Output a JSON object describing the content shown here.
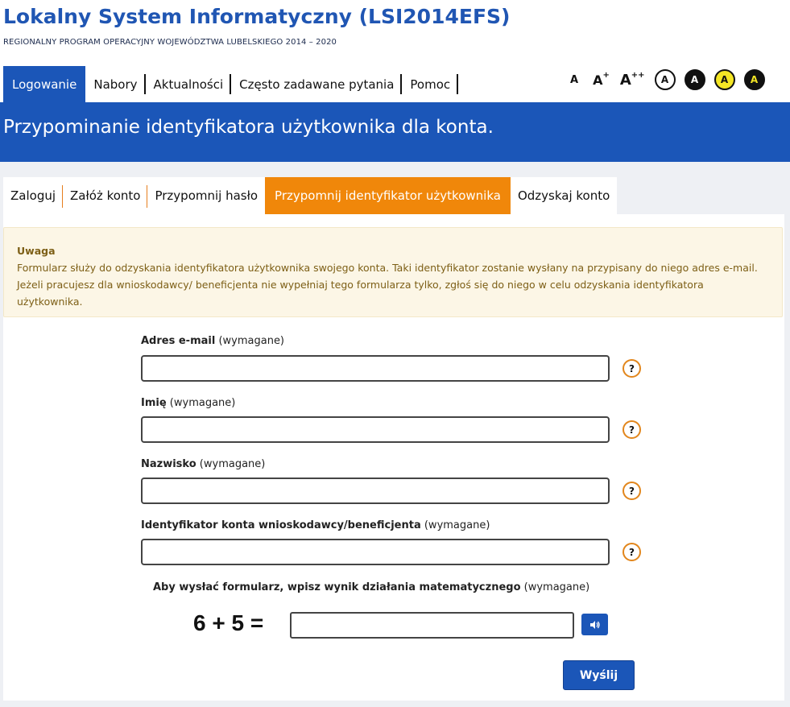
{
  "header": {
    "title": "Lokalny System Informatyczny (LSI2014EFS)",
    "subtitle": "REGIONALNY PROGRAM OPERACYJNY WOJEWÓDZTWA LUBELSKIEGO 2014 – 2020"
  },
  "nav": {
    "items": [
      {
        "label": "Logowanie",
        "active": true
      },
      {
        "label": "Nabory"
      },
      {
        "label": "Aktualności"
      },
      {
        "label": "Często zadawane pytania"
      },
      {
        "label": "Pomoc"
      }
    ]
  },
  "accessibility": {
    "font_small": "A",
    "font_medium": "A",
    "font_medium_sup": "+",
    "font_large": "A",
    "font_large_sup": "++",
    "contrast_labels": [
      "A",
      "A",
      "A",
      "A"
    ]
  },
  "banner": {
    "title": "Przypominanie identyfikatora użytkownika dla konta."
  },
  "tabs": [
    {
      "label": "Zaloguj"
    },
    {
      "label": "Załóż konto"
    },
    {
      "label": "Przypomnij hasło"
    },
    {
      "label": "Przypomnij identyfikator użytkownika",
      "active": true
    },
    {
      "label": "Odzyskaj konto"
    }
  ],
  "alert": {
    "title": "Uwaga",
    "line1": "Formularz służy do odzyskania identyfikatora użytkownika swojego konta. Taki identyfikator zostanie wysłany na przypisany do niego adres e-mail.",
    "line2": "Jeżeli pracujesz dla wnioskodawcy/ beneficjenta nie wypełniaj tego formularza tylko, zgłoś się do niego w celu odzyskania identyfikatora",
    "line3": "użytkownika."
  },
  "form": {
    "required_suffix": "(wymagane)",
    "fields": [
      {
        "label": "Adres e-mail",
        "value": ""
      },
      {
        "label": "Imię",
        "value": ""
      },
      {
        "label": "Nazwisko",
        "value": ""
      },
      {
        "label": "Identyfikator konta wnioskodawcy/beneficjenta",
        "value": ""
      }
    ],
    "help_glyph": "?",
    "captcha_label": "Aby wysłać formularz, wpisz wynik działania matematycznego",
    "captcha_expression": "6 + 5 =",
    "captcha_value": "",
    "submit_label": "Wyślij"
  },
  "colors": {
    "brand_blue": "#1b56b8",
    "active_tab_orange": "#f0870a",
    "alert_bg": "#fcf6e6",
    "help_ring": "#e2861c"
  }
}
